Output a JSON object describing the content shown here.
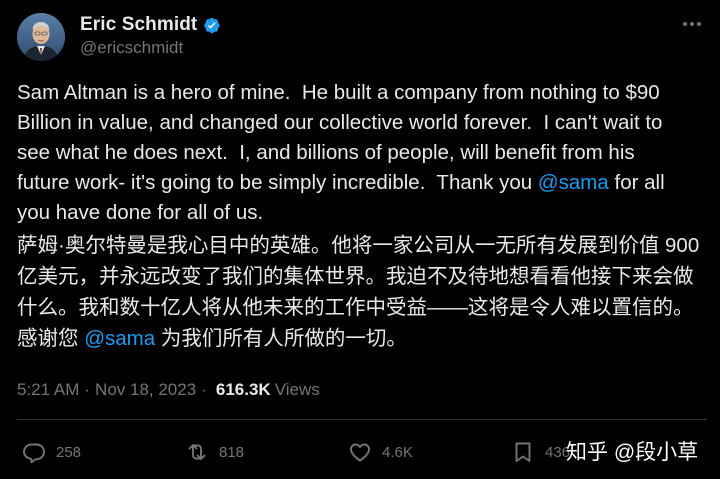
{
  "author": {
    "display_name": "Eric Schmidt",
    "handle": "@ericschmidt",
    "verified": true
  },
  "tweet": {
    "en_segments": [
      "Sam Altman is a hero of mine.  He built a company from nothing to $90\nBillion in value, and changed our collective world forever.  I can't wait to\nsee what he does next.  I, and billions of people, will benefit from his\nfuture work- it's going to be simply incredible.  Thank you ",
      "@sama",
      " for all\nyou have done for all of us."
    ],
    "zh_segments": [
      "萨姆·奥尔特曼是我心目中的英雄。他将一家公司从一无所有发展到价值 900 亿美元，并永远改变了我们的集体世界。我迫不及待地想看看他接下来会做什么。我和数十亿人将从他未来的工作中受益——这将是令人难以置信的。感谢您 ",
      "@sama",
      " 为我们所有人所做的一切。"
    ]
  },
  "meta": {
    "time": "5:21 AM",
    "date": "Nov 18, 2023",
    "views_count": "616.3K",
    "views_label": "Views"
  },
  "actions": {
    "replies": "258",
    "reposts": "818",
    "likes": "4.6K",
    "bookmarks": "436"
  },
  "watermark": "知乎 @段小草",
  "icons": {
    "verified": "verified-badge-icon",
    "more": "more-options-icon",
    "reply": "reply-icon",
    "repost": "repost-icon",
    "like": "heart-icon",
    "bookmark": "bookmark-icon"
  },
  "colors": {
    "background": "#000000",
    "text": "#e7e9ea",
    "muted": "#71767b",
    "accent": "#1d9bf0",
    "divider": "#2f3336"
  }
}
